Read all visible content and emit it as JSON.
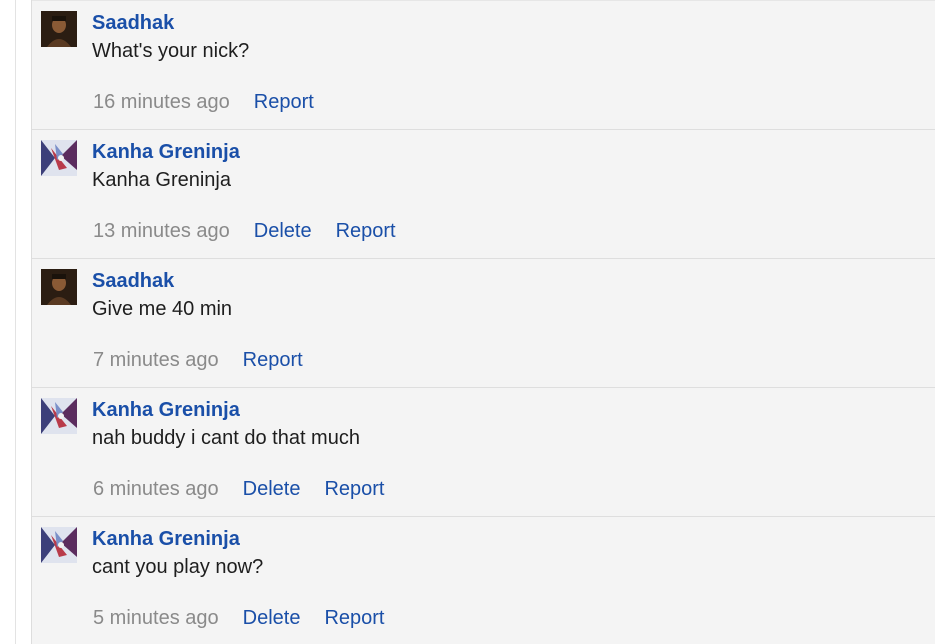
{
  "comments": [
    {
      "author": "Saadhak",
      "avatar_icon": "user-avatar-saadhak",
      "text": "What's your nick?",
      "time": "16 minutes ago",
      "delete_label": "",
      "report_label": "Report"
    },
    {
      "author": "Kanha Greninja",
      "avatar_icon": "user-avatar-greninja",
      "text": "Kanha Greninja",
      "time": "13 minutes ago",
      "delete_label": "Delete",
      "report_label": "Report"
    },
    {
      "author": "Saadhak",
      "avatar_icon": "user-avatar-saadhak",
      "text": "Give me 40 min",
      "time": "7 minutes ago",
      "delete_label": "",
      "report_label": "Report"
    },
    {
      "author": "Kanha Greninja",
      "avatar_icon": "user-avatar-greninja",
      "text": "nah buddy i cant do that much",
      "time": "6 minutes ago",
      "delete_label": "Delete",
      "report_label": "Report"
    },
    {
      "author": "Kanha Greninja",
      "avatar_icon": "user-avatar-greninja",
      "text": "cant you play now?",
      "time": "5 minutes ago",
      "delete_label": "Delete",
      "report_label": "Report"
    }
  ],
  "colors": {
    "link": "#1a4fa8",
    "timestamp": "#8a8a8a",
    "thread_bg": "#f4f4f4"
  }
}
